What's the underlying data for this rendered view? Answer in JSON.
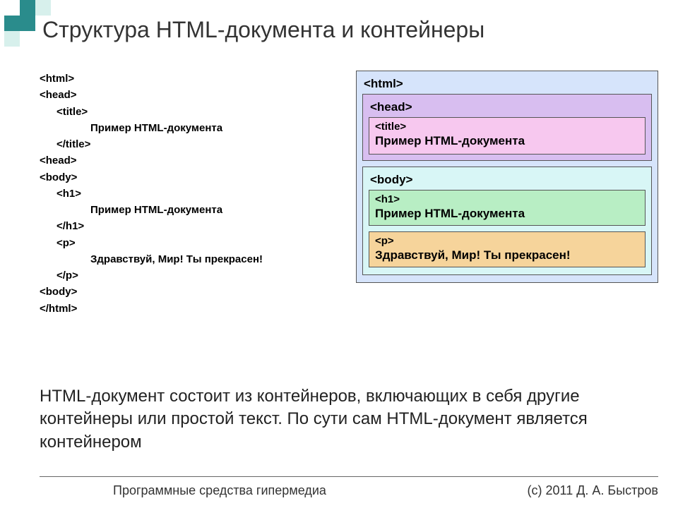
{
  "title": "Структура HTML-документа и контейнеры",
  "code": {
    "l1": "<html>",
    "l2": "<head>",
    "l3": "<title>",
    "l4": "Пример HTML-документа",
    "l5": "</title>",
    "l6": "<head>",
    "l7": "<body>",
    "l8": "<h1>",
    "l9": "Пример HTML-документа",
    "l10": "</h1>",
    "l11": "<p>",
    "l12": "Здравствуй, Мир! Ты прекрасен!",
    "l13": "</p>",
    "l14": "<body>",
    "l15": "</html>"
  },
  "diagram": {
    "html_label": "<html>",
    "head_label": "<head>",
    "title_label": "<title>",
    "title_text": "Пример HTML-документа",
    "body_label": "<body>",
    "h1_label": "<h1>",
    "h1_text": "Пример HTML-документа",
    "p_label": "<p>",
    "p_text": "Здравствуй, Мир! Ты прекрасен!"
  },
  "paragraph": "HTML-документ состоит из контейнеров, включающих в себя другие контейнеры или простой текст. По сути сам HTML-документ является контейнером",
  "footer": {
    "left": "Программные средства гипермедиа",
    "right": "(с) 2011    Д. А. Быстров"
  }
}
